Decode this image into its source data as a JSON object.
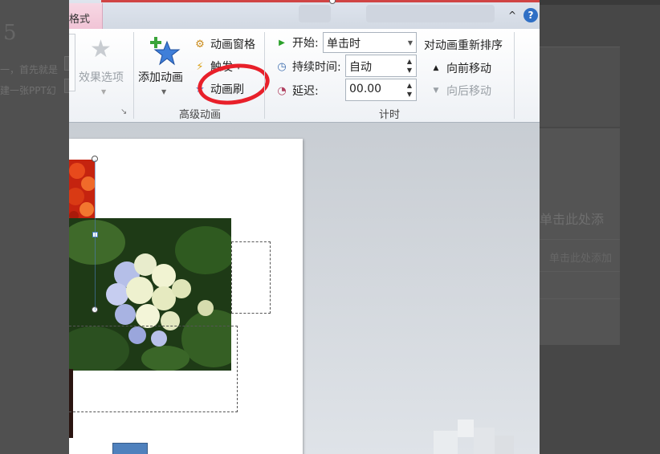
{
  "background": {
    "left_digit": "5",
    "left_line1": "一，首先就是",
    "left_line2": "建一张PPT幻",
    "right_title": "单击此处添",
    "right_subtitle": "单击此处添加"
  },
  "titlebar": {
    "context_tab": "格式",
    "minimize_ribbon_glyph": "^",
    "help_glyph": "?"
  },
  "ribbon": {
    "effect_options": {
      "label": "效果选项"
    },
    "advanced_animation": {
      "add_animation_label": "添加动画",
      "animation_pane_label": "动画窗格",
      "trigger_label": "触发",
      "animation_painter_label": "动画刷",
      "group_label": "高级动画"
    },
    "timing": {
      "start_label": "开始:",
      "start_value": "单击时",
      "duration_label": "持续时间:",
      "duration_value": "自动",
      "delay_label": "延迟:",
      "delay_value": "00.00",
      "reorder_title": "对动画重新排序",
      "move_earlier": "向前移动",
      "move_later": "向后移动",
      "group_label": "计时"
    }
  },
  "colors": {
    "accent_blue": "#4f81bd",
    "annotation_red": "#e8202a",
    "context_tab_pink": "#f1c4d6"
  }
}
